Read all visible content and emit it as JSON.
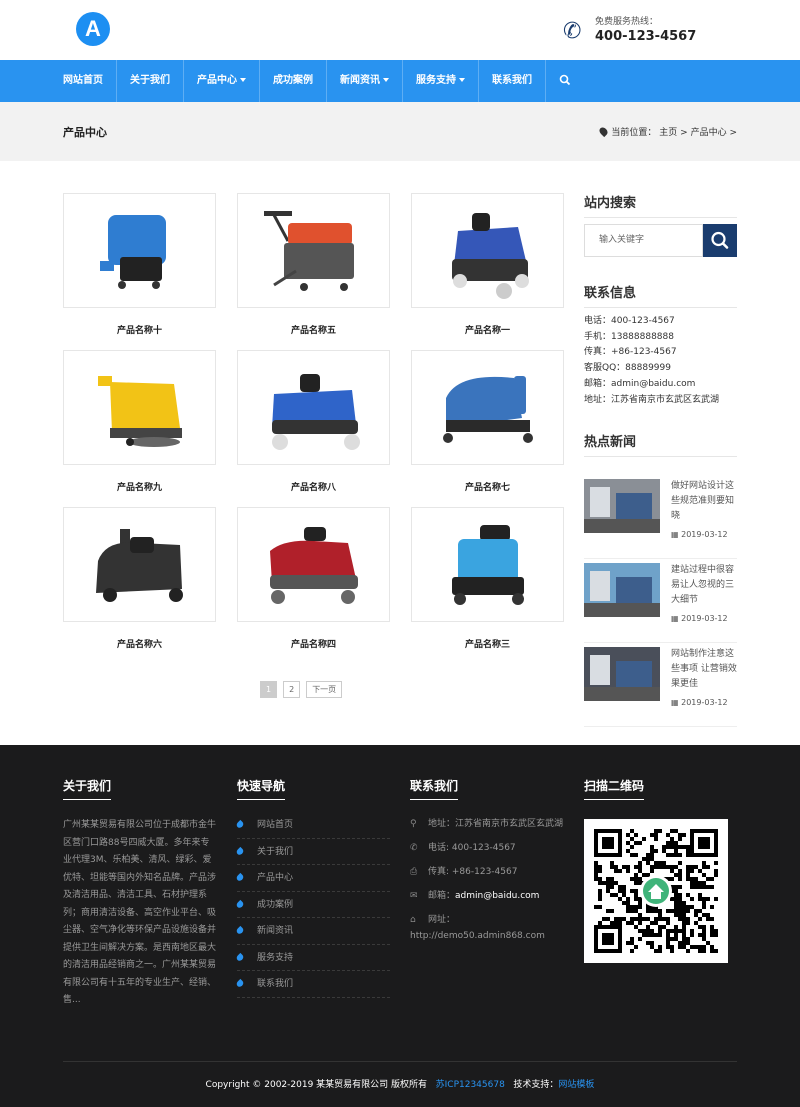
{
  "header": {
    "logo_letter": "A",
    "hotline_label": "免费服务热线：",
    "hotline_number": "400-123-4567"
  },
  "nav": {
    "items": [
      {
        "label": "网站首页",
        "dropdown": false
      },
      {
        "label": "关于我们",
        "dropdown": false
      },
      {
        "label": "产品中心",
        "dropdown": true
      },
      {
        "label": "成功案例",
        "dropdown": false
      },
      {
        "label": "新闻资讯",
        "dropdown": true
      },
      {
        "label": "服务支持",
        "dropdown": true
      },
      {
        "label": "联系我们",
        "dropdown": false
      }
    ]
  },
  "banner": {
    "title": "产品中心",
    "crumb_prefix": "当前位置：",
    "crumb_home": "主页",
    "crumb_current": "产品中心"
  },
  "products": [
    {
      "name": "产品名称十",
      "color": "#2f7dd1"
    },
    {
      "name": "产品名称五",
      "color": "#e0512e"
    },
    {
      "name": "产品名称一",
      "color": "#3557b8"
    },
    {
      "name": "产品名称九",
      "color": "#f2c316"
    },
    {
      "name": "产品名称八",
      "color": "#2f64c9"
    },
    {
      "name": "产品名称七",
      "color": "#3a74bd"
    },
    {
      "name": "产品名称六",
      "color": "#333333"
    },
    {
      "name": "产品名称四",
      "color": "#b0202a"
    },
    {
      "name": "产品名称三",
      "color": "#3aa4e0"
    }
  ],
  "pager": {
    "page1": "1",
    "page2": "2",
    "next": "下一页"
  },
  "sidebar": {
    "search_title": "站内搜索",
    "search_placeholder": "输入关键字",
    "contact_title": "联系信息",
    "contact_lines": [
      "电话：400-123-4567",
      "手机：13888888888",
      "传真：+86-123-4567",
      "客服QQ：88889999",
      "邮箱：admin@baidu.com",
      "地址：江苏省南京市玄武区玄武湖"
    ],
    "news_title": "热点新闻",
    "news": [
      {
        "title": "做好网站设计这些规范准则要知晓",
        "date": "2019-03-12"
      },
      {
        "title": "建站过程中很容易让人忽视的三大细节",
        "date": "2019-03-12"
      },
      {
        "title": "网站制作注意这些事项 让营销效果更佳",
        "date": "2019-03-12"
      }
    ]
  },
  "footer": {
    "about_title": "关于我们",
    "about_text": "广州某某贸易有限公司位于成都市金牛区营门口路88号四威大厦。多年来专业代理3M、乐柏美、清风、绿彩、爱优特、坦能等国内外知名品牌。产品涉及清洁用品、清洁工具、石材护理系列；商用清洁设备、高空作业平台、吸尘器、空气净化等环保产品设施设备并提供卫生间解决方案。是西南地区最大的清洁用品经销商之一。广州某某贸易有限公司有十五年的专业生产、经销、售...",
    "quicknav_title": "快速导航",
    "quicknav": [
      "网站首页",
      "关于我们",
      "产品中心",
      "成功案例",
      "新闻资讯",
      "服务支持",
      "联系我们"
    ],
    "contact_title": "联系我们",
    "contact": {
      "address": "地址：江苏省南京市玄武区玄武湖",
      "phone": "电话: 400-123-4567",
      "fax": "传真: +86-123-4567",
      "email_label": "邮箱：",
      "email": "admin@baidu.com",
      "web_label": "网址：",
      "web": "http://demo50.admin868.com"
    },
    "qr_title": "扫描二维码",
    "copyright": "Copyright © 2002-2019 某某贸易有限公司 版权所有",
    "icp": "苏ICP12345678",
    "support_label": "技术支持：",
    "support_link": "网站模板"
  }
}
